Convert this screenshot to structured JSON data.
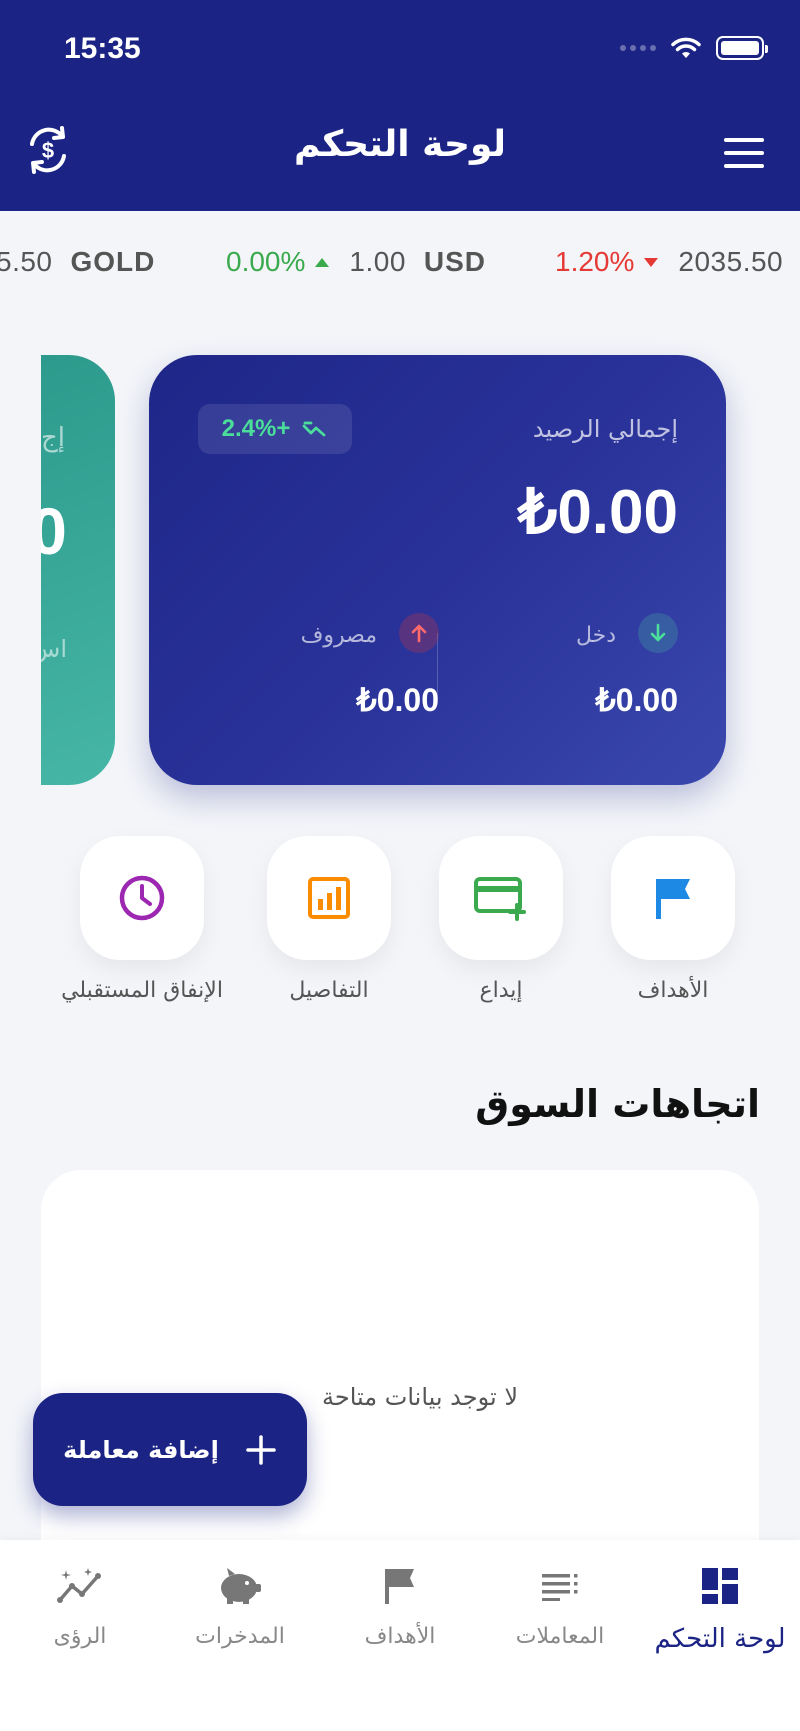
{
  "status_bar": {
    "time": "15:35"
  },
  "header": {
    "title": "لوحة التحكم",
    "currency_icon": "currency-exchange-icon",
    "menu_icon": "hamburger-menu-icon"
  },
  "ticker": [
    {
      "value": "5.50",
      "symbol": "GOLD"
    },
    {
      "change": "0.00%",
      "direction": "up",
      "value": "1.00",
      "symbol": "USD"
    },
    {
      "change": "1.20%",
      "direction": "down",
      "value": "2035.50"
    }
  ],
  "teal_card": {
    "label": "إج",
    "amount": "0",
    "sub": "اس"
  },
  "balance_card": {
    "growth": "2.4%+",
    "label": "إجمالي الرصيد",
    "amount": "₺0.00",
    "income": {
      "label": "دخل",
      "amount": "₺0.00"
    },
    "expense": {
      "label": "مصروف",
      "amount": "₺0.00"
    }
  },
  "quick_actions": [
    {
      "label": "الأهداف",
      "icon": "flag-icon"
    },
    {
      "label": "إيداع",
      "icon": "card-add-icon"
    },
    {
      "label": "التفاصيل",
      "icon": "chart-icon"
    },
    {
      "label": "الإنفاق المستقبلي",
      "icon": "clock-icon"
    }
  ],
  "market": {
    "title": "اتجاهات السوق",
    "empty": "لا توجد بيانات متاحة"
  },
  "fab": {
    "label": "إضافة معاملة"
  },
  "bottom_nav": [
    {
      "label": "لوحة التحكم",
      "icon": "dashboard-icon",
      "active": true
    },
    {
      "label": "المعاملات",
      "icon": "list-icon"
    },
    {
      "label": "الأهداف",
      "icon": "flag-icon"
    },
    {
      "label": "المدخرات",
      "icon": "piggy-bank-icon"
    },
    {
      "label": "الرؤى",
      "icon": "insights-icon"
    }
  ],
  "colors": {
    "primary": "#1B2385",
    "teal": "#3AAA9A",
    "up": "#3BAA4E",
    "down": "#E53935",
    "accent_green": "#4ADE9A"
  }
}
